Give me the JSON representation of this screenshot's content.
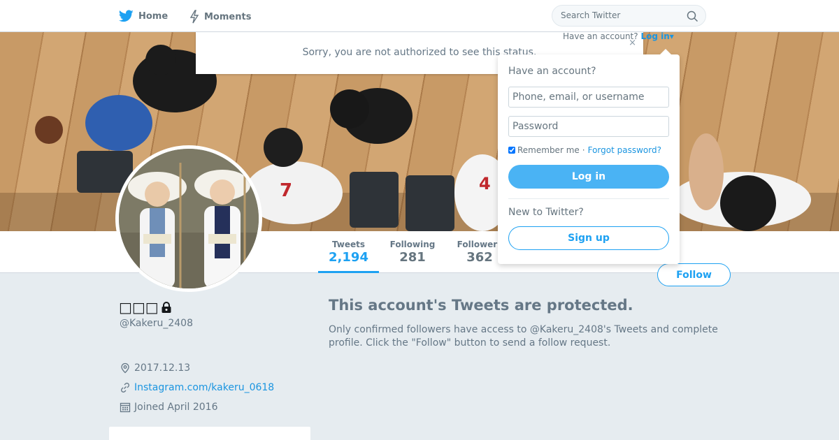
{
  "nav": {
    "home_label": "Home",
    "moments_label": "Moments",
    "search_placeholder": "Search Twitter"
  },
  "error_bar": {
    "message": "Sorry, you are not authorized to see this status.",
    "close_glyph": "×"
  },
  "login": {
    "hint_text": "Have an account?",
    "hint_link": "Log in",
    "title": "Have an account?",
    "username_placeholder": "Phone, email, or username",
    "password_placeholder": "Password",
    "remember_label": "Remember me",
    "separator": "·",
    "forgot_label": "Forgot password?",
    "login_button": "Log in",
    "new_label": "New to Twitter?",
    "signup_button": "Sign up",
    "remember_checked": true
  },
  "profile": {
    "name": "□□□",
    "handle": "@Kakeru_2408",
    "location": "2017.12.13",
    "url": "Instagram.com/kakeru_0618",
    "joined": "Joined April 2016"
  },
  "stats": [
    {
      "label": "Tweets",
      "value": "2,194"
    },
    {
      "label": "Following",
      "value": "281"
    },
    {
      "label": "Followers",
      "value": "362"
    }
  ],
  "follow_button": "Follow",
  "protected": {
    "title": "This account's Tweets are protected.",
    "description": "Only confirmed followers have access to @Kakeru_2408's Tweets and complete profile. Click the \"Follow\" button to send a follow request."
  },
  "colors": {
    "accent": "#1da1f2",
    "link": "#1b95e0",
    "background": "#e6ecf0"
  },
  "icons": [
    "twitter-bird-icon",
    "lightning-icon",
    "search-icon",
    "lock-icon",
    "location-pin-icon",
    "link-icon",
    "calendar-icon",
    "close-icon"
  ]
}
